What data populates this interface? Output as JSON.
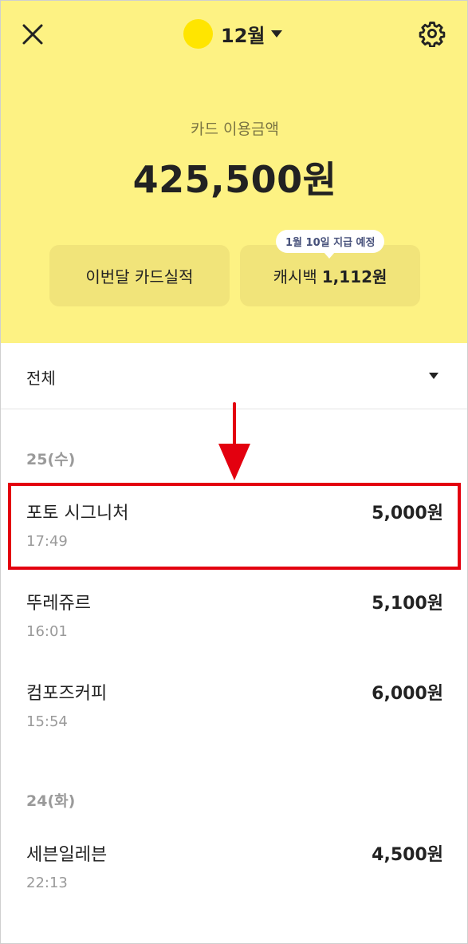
{
  "header": {
    "month": "12월",
    "icons": {
      "close": "close-icon",
      "settings": "gear-icon",
      "month_dropdown": "caret-down-icon"
    },
    "colors": {
      "background": "#fdf283",
      "month_dot": "#ffe500",
      "button_bg": "#f1e47a"
    }
  },
  "summary": {
    "label": "카드 이용금액",
    "amount": "425,500원"
  },
  "buttons": {
    "card_performance": "이번달 카드실적",
    "cashback_label": "캐시백",
    "cashback_amount": "1,112원",
    "cashback_tooltip": "1월 10일 지급 예정"
  },
  "filter": {
    "selected": "전체"
  },
  "groups": [
    {
      "date": "25(수)",
      "items": [
        {
          "name": "포토 시그니처",
          "time": "17:49",
          "amount": "5,000원"
        },
        {
          "name": "뚜레쥬르",
          "time": "16:01",
          "amount": "5,100원"
        },
        {
          "name": "컴포즈커피",
          "time": "15:54",
          "amount": "6,000원"
        }
      ]
    },
    {
      "date": "24(화)",
      "items": [
        {
          "name": "세븐일레븐",
          "time": "22:13",
          "amount": "4,500원"
        }
      ]
    }
  ],
  "annotation": {
    "color": "#e3000f"
  }
}
